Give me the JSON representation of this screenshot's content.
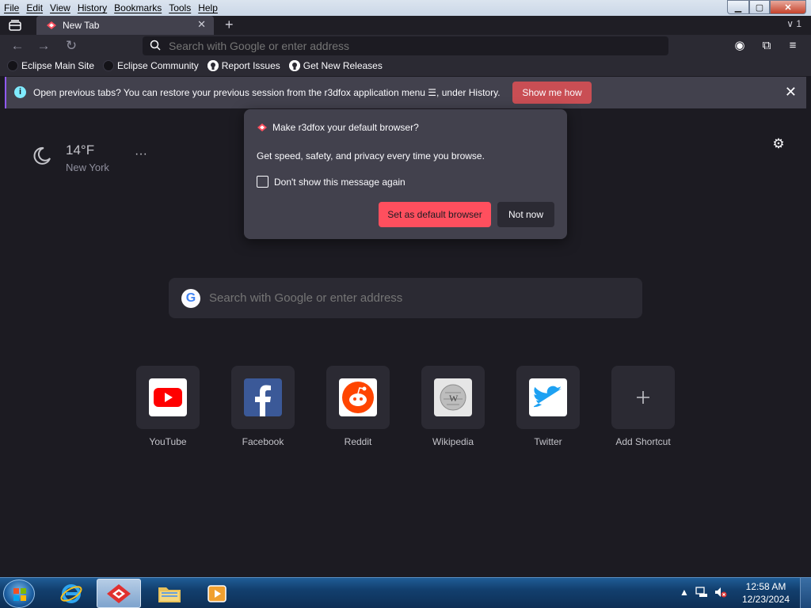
{
  "window": {
    "menu": [
      "File",
      "Edit",
      "View",
      "History",
      "Bookmarks",
      "Tools",
      "Help"
    ],
    "controls": {
      "minimize": "▁",
      "maximize": "▢",
      "close": "✕"
    }
  },
  "tabs": {
    "active_title": "New Tab",
    "close_glyph": "✕",
    "new_tab_glyph": "+",
    "list_all": "∨ 1"
  },
  "navbar": {
    "back_glyph": "←",
    "forward_glyph": "→",
    "reload_glyph": "↻",
    "url_placeholder": "Search with Google or enter address",
    "account_glyph": "◉",
    "extensions_glyph": "⧉",
    "menu_glyph": "≡"
  },
  "bookmarks": [
    {
      "label": "Eclipse Main Site",
      "icon": "eclipse-icon"
    },
    {
      "label": "Eclipse Community",
      "icon": "eclipse-icon"
    },
    {
      "label": "Report Issues",
      "icon": "github-icon"
    },
    {
      "label": "Get New Releases",
      "icon": "github-icon"
    }
  ],
  "notification": {
    "message_bold": "Open previous tabs?",
    "message_rest": " You can restore your previous session from the r3dfox application menu ☰, under History.",
    "button": "Show me how",
    "close_glyph": "✕"
  },
  "weather": {
    "temperature": "14°F",
    "city": "New York",
    "more_glyph": "···"
  },
  "settings_glyph": "⚙",
  "search": {
    "placeholder": "Search with Google or enter address",
    "g_glyph": "G"
  },
  "shortcuts": [
    {
      "label": "YouTube",
      "icon": "youtube-icon",
      "color": "#ff0000"
    },
    {
      "label": "Facebook",
      "icon": "facebook-icon",
      "color": "#3b5998"
    },
    {
      "label": "Reddit",
      "icon": "reddit-icon",
      "color": "#ff4500"
    },
    {
      "label": "Wikipedia",
      "icon": "wikipedia-icon",
      "color": "#cccccc"
    },
    {
      "label": "Twitter",
      "icon": "twitter-icon",
      "color": "#1da1f2"
    },
    {
      "label": "Add Shortcut",
      "icon": "plus-icon",
      "color": "#2b2a33"
    }
  ],
  "popup": {
    "title": "Make r3dfox your default browser?",
    "body": "Get speed, safety, and privacy every time you browse.",
    "checkbox_label": "Don't show this message again",
    "primary_button": "Set as default browser",
    "secondary_button": "Not now"
  },
  "taskbar": {
    "time": "12:58 AM",
    "date": "12/23/2024",
    "tray_up_glyph": "▲"
  },
  "colors": {
    "accent": "#ff4f5e",
    "notification_button": "#c94e54",
    "background": "#1c1b22",
    "panel": "#42414d"
  }
}
